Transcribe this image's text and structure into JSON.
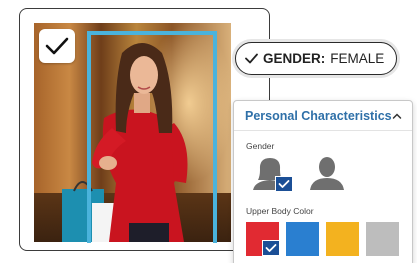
{
  "gender_tag": {
    "key": "GENDER:",
    "value": "FEMALE"
  },
  "panel": {
    "title": "Personal Characteristics",
    "gender_section": {
      "label": "Gender",
      "options": [
        {
          "name": "female",
          "selected": true
        },
        {
          "name": "male",
          "selected": false
        }
      ]
    },
    "color_section": {
      "label": "Upper Body Color",
      "swatches": [
        {
          "color": "#e12a32",
          "selected": true
        },
        {
          "color": "#2a7fd0",
          "selected": false
        },
        {
          "color": "#f3b21f",
          "selected": false
        },
        {
          "color": "#bdbdbd",
          "selected": false
        }
      ]
    }
  },
  "colors": {
    "accent_blue": "#2f70a8",
    "check_fill": "#1b4f96",
    "detection_box": "#4ab3dc",
    "icon_gray": "#6f6f6f"
  },
  "photo": {
    "selected": true
  }
}
